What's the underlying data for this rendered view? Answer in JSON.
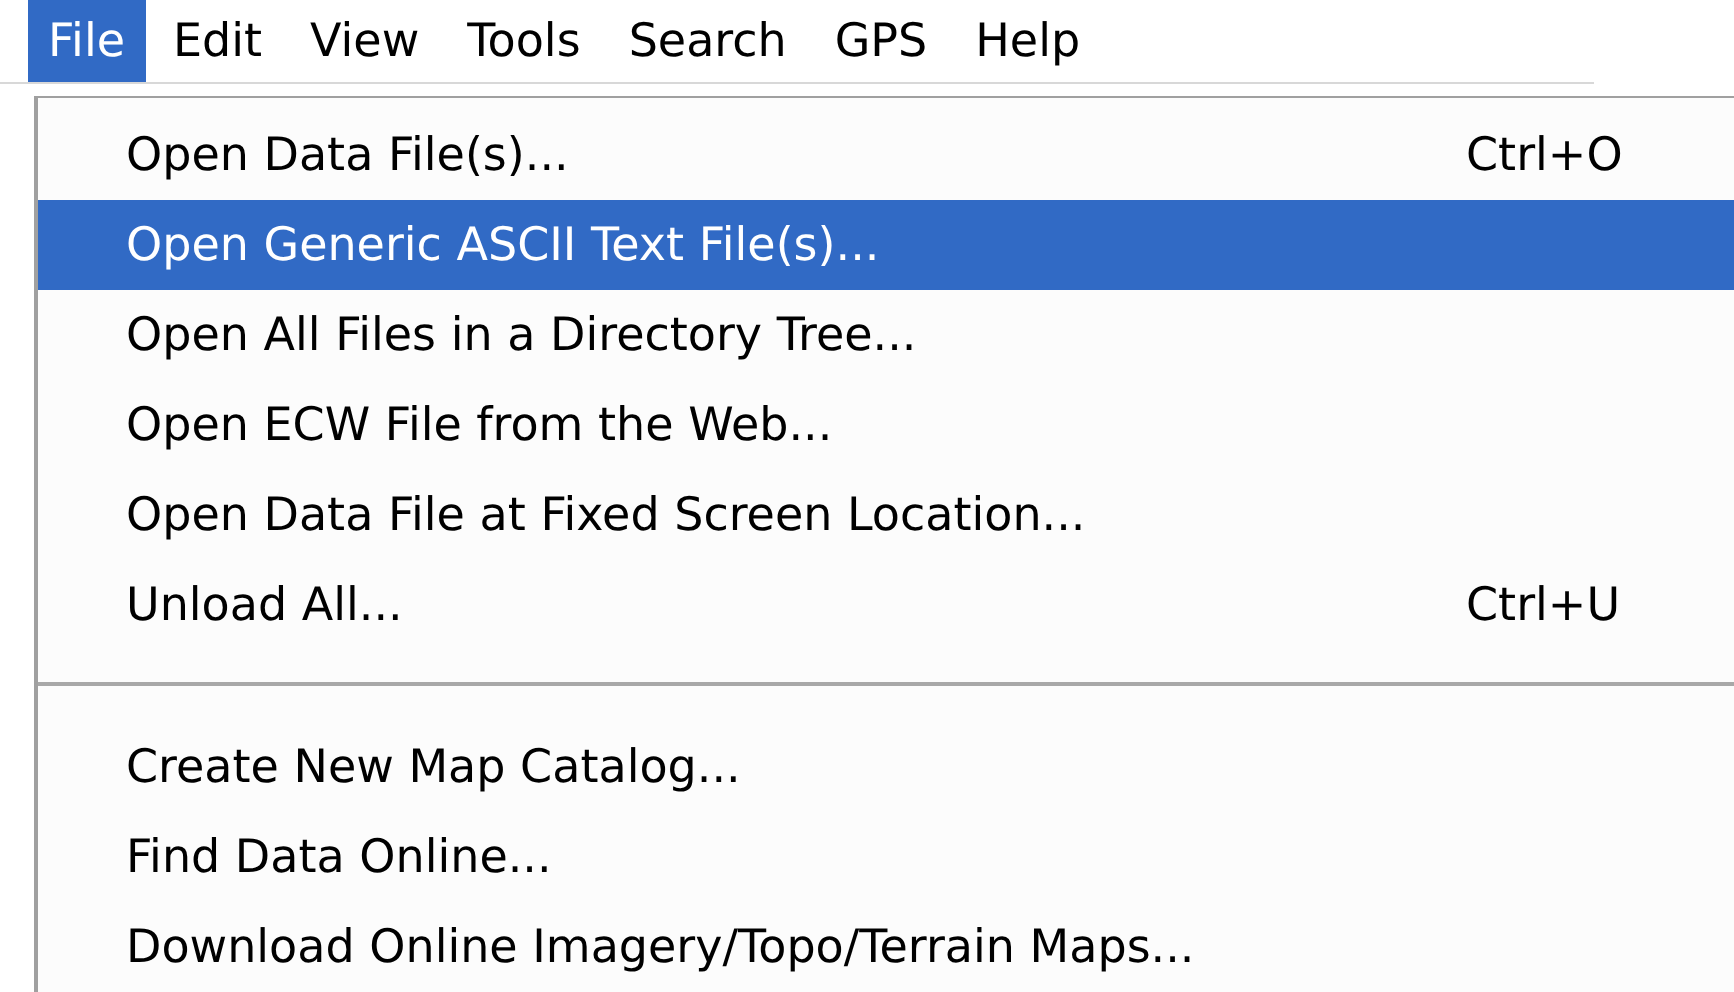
{
  "menu_bar": [
    {
      "label": "File",
      "selected": true
    },
    {
      "label": "Edit",
      "selected": false
    },
    {
      "label": "View",
      "selected": false
    },
    {
      "label": "Tools",
      "selected": false
    },
    {
      "label": "Search",
      "selected": false
    },
    {
      "label": "GPS",
      "selected": false
    },
    {
      "label": "Help",
      "selected": false
    }
  ],
  "file_menu": [
    {
      "kind": "item",
      "label": "Open Data File(s)...",
      "shortcut": "Ctrl+O",
      "selected": false
    },
    {
      "kind": "item",
      "label": "Open Generic ASCII Text File(s)...",
      "selected": true
    },
    {
      "kind": "item",
      "label": "Open All Files in a Directory Tree...",
      "selected": false
    },
    {
      "kind": "item",
      "label": "Open ECW File from the Web...",
      "selected": false
    },
    {
      "kind": "item",
      "label": "Open Data File at Fixed Screen Location...",
      "selected": false
    },
    {
      "kind": "item",
      "label": "Unload All...",
      "shortcut": "Ctrl+U",
      "selected": false
    },
    {
      "kind": "separator"
    },
    {
      "kind": "item",
      "label": "Create New Map Catalog...",
      "selected": false
    },
    {
      "kind": "item",
      "label": "Find Data Online...",
      "selected": false
    },
    {
      "kind": "item",
      "label": "Download Online Imagery/Topo/Terrain Maps...",
      "selected": false
    }
  ]
}
